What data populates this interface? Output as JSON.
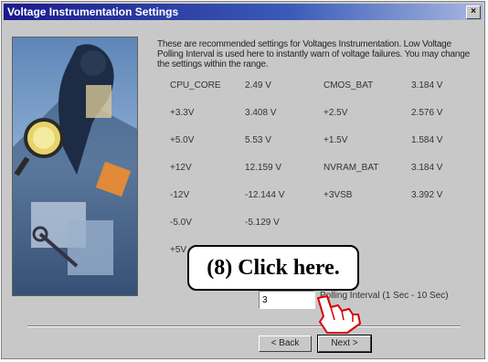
{
  "window": {
    "title": "Voltage Instrumentation Settings",
    "close_label": "×"
  },
  "description": "These are recommended settings for Voltages Instrumentation. Low Voltage Polling Interval is used here to instantly warn of voltage failures. You may change the settings within the range.",
  "voltages": [
    {
      "label": "CPU_CORE",
      "value": "2.49 V",
      "label2": "CMOS_BAT",
      "value2": "3.184 V"
    },
    {
      "label": "+3.3V",
      "value": "3.408 V",
      "label2": "+2.5V",
      "value2": "2.576 V"
    },
    {
      "label": "+5.0V",
      "value": "5.53 V",
      "label2": "+1.5V",
      "value2": "1.584 V"
    },
    {
      "label": "+12V",
      "value": "12.159 V",
      "label2": "NVRAM_BAT",
      "value2": "3.184 V"
    },
    {
      "label": "-12V",
      "value": "-12.144 V",
      "label2": "+3VSB",
      "value2": "3.392 V"
    },
    {
      "label": "-5.0V",
      "value": "-5.129 V",
      "label2": "",
      "value2": ""
    },
    {
      "label": "+5V",
      "value": "",
      "label2": "",
      "value2": ""
    }
  ],
  "polling": {
    "value": "3",
    "label": "Polling Interval (1 Sec - 10 Sec)"
  },
  "buttons": {
    "back": "< Back",
    "next": "Next >"
  },
  "callout": {
    "text": "(8)  Click here."
  },
  "icons": {
    "pointer": "hand-pointer-icon",
    "close": "close-icon"
  }
}
